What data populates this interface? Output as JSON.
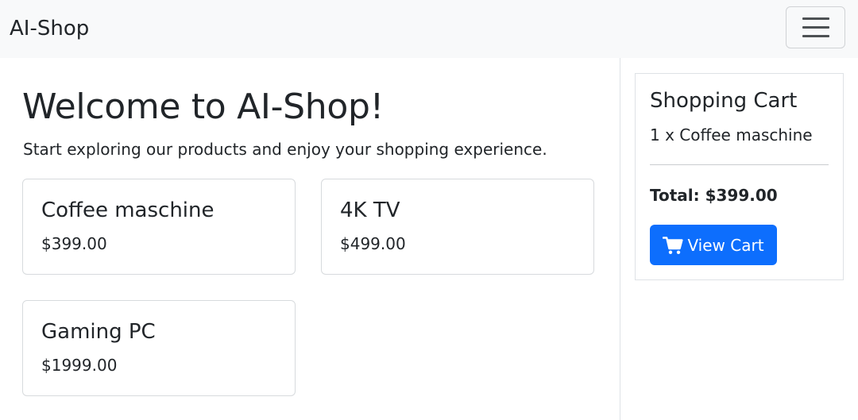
{
  "navbar": {
    "brand": "AI-Shop",
    "toggler_icon": "hamburger-menu-icon"
  },
  "hero": {
    "title": "Welcome to AI-Shop!",
    "subtitle": "Start exploring our products and enjoy your shopping experience."
  },
  "products": [
    {
      "name": "Coffee maschine",
      "price": "$399.00"
    },
    {
      "name": "4K TV",
      "price": "$499.00"
    },
    {
      "name": "Gaming PC",
      "price": "$1999.00"
    }
  ],
  "cart": {
    "title": "Shopping Cart",
    "items": [
      "1 x Coffee maschine"
    ],
    "total": "Total: $399.00",
    "button_label": "View Cart",
    "button_icon": "shopping-cart-icon"
  },
  "colors": {
    "primary": "#0d6efd",
    "navbar_bg": "#f8f9fa",
    "text": "#212529"
  }
}
